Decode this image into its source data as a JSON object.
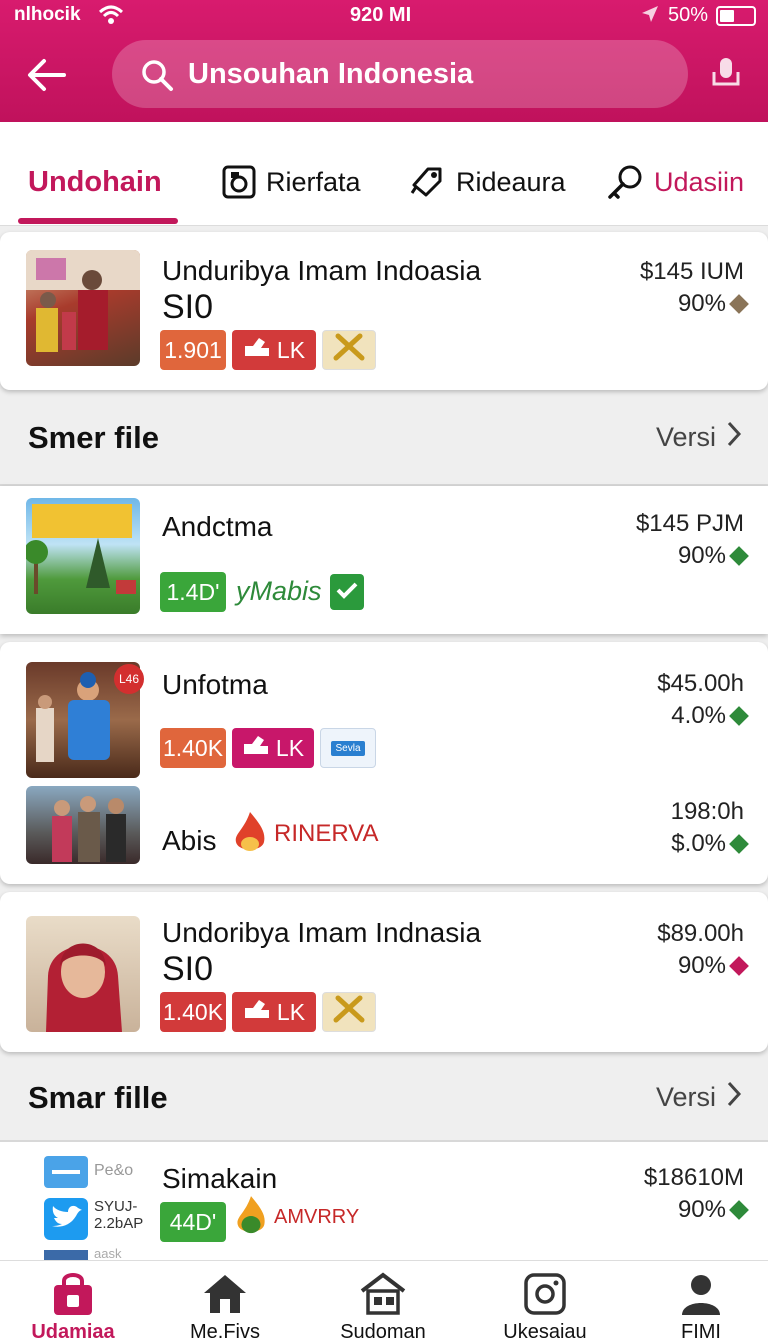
{
  "status": {
    "carrier": "nlhocik",
    "time": "920 MI",
    "battery": "50%"
  },
  "search": {
    "query": "Unsouhan Indonesia"
  },
  "tabs": [
    {
      "label": "Undohain",
      "icon": "none",
      "active": true
    },
    {
      "label": "Rierfata",
      "icon": "square-logo-icon"
    },
    {
      "label": "Rideaura",
      "icon": "tag-icon"
    },
    {
      "label": "Udasiin",
      "icon": "key-icon"
    }
  ],
  "products": [
    {
      "title": "Unduribya Imam Indoasia",
      "subtitle": "SI0",
      "price": "$145 IUM",
      "pct": "90%",
      "trend_color": "#8a7458",
      "badges": [
        "1.901",
        "LK",
        ""
      ]
    },
    {
      "title": "Andctma",
      "price": "$145 PJM",
      "pct": "90%",
      "trend_color": "#2e8a3a",
      "badges": [
        "1.4D'",
        "yMabis",
        ""
      ]
    },
    {
      "title": "Unfotma",
      "price": "$45.00h",
      "pct": "4.0%",
      "trend_color": "#2e8a3a",
      "corner_badge": "L46",
      "badges": [
        "1.40K",
        "LK",
        "Sevla"
      ]
    },
    {
      "title": "Abis",
      "brand": "RINERVA",
      "price": "198:0h",
      "pct": "$.0%",
      "trend_color": "#2e8a3a"
    },
    {
      "title": "Undoribya Imam Indnasia",
      "subtitle": "SI0",
      "price": "$89.00h",
      "pct": "90%",
      "trend_color": "#c2185b",
      "badges": [
        "1.40K",
        "LK",
        ""
      ]
    },
    {
      "title": "Simakain",
      "price": "$18610M",
      "pct": "90%",
      "trend_color": "#2e8a3a",
      "brand": "AMVRRY",
      "badges": [
        "44D'"
      ],
      "thumb_labels": [
        "Pe&o",
        "SYUJ-",
        "2.2bAP",
        "aask"
      ]
    }
  ],
  "sections": [
    {
      "title": "Smer file",
      "link": "Versi"
    },
    {
      "title": "Smar fille",
      "link": "Versi"
    }
  ],
  "nav": [
    {
      "label": "Udamiaa",
      "icon": "shopping-bag-icon",
      "active": true
    },
    {
      "label": "Me.Fivs",
      "icon": "home-icon"
    },
    {
      "label": "Sudoman",
      "icon": "store-icon"
    },
    {
      "label": "Ukesaiau",
      "icon": "camera-icon"
    },
    {
      "label": "FIMI",
      "icon": "person-icon"
    }
  ],
  "colors": {
    "brand": "#c2185b",
    "green": "#3aa63a",
    "orange": "#e0663c"
  }
}
